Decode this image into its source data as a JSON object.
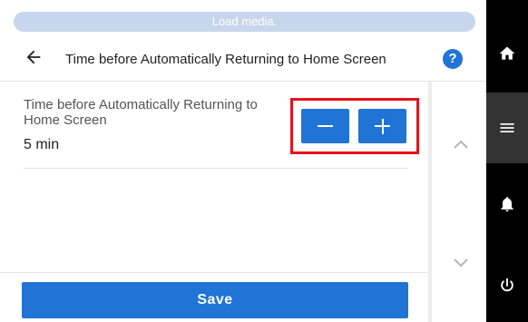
{
  "status": {
    "message": "Load media."
  },
  "header": {
    "back_icon": "arrow-left-icon",
    "title": "Time before Automatically Returning to Home Screen",
    "help_label": "?"
  },
  "setting": {
    "label": "Time before Automatically Returning to Home Screen",
    "value": "5 min",
    "decrease_icon": "minus-icon",
    "increase_icon": "plus-icon"
  },
  "scroll": {
    "up_icon": "chevron-up-icon",
    "down_icon": "chevron-down-icon"
  },
  "footer": {
    "save_label": "Save"
  },
  "side_nav": {
    "items": [
      {
        "icon": "home-icon",
        "active": false
      },
      {
        "icon": "menu-icon",
        "active": true
      },
      {
        "icon": "bell-icon",
        "active": false
      },
      {
        "icon": "power-icon",
        "active": false
      }
    ]
  },
  "colors": {
    "accent": "#1f74d6",
    "highlight_frame": "#e8101b",
    "status_pill": "#c7d6ec",
    "side_nav": "#000000",
    "side_nav_active": "#333333"
  }
}
